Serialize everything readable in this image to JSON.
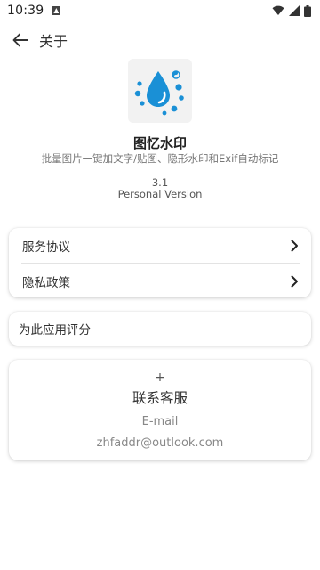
{
  "status_bar": {
    "time": "10:39"
  },
  "app_bar": {
    "title": "关于"
  },
  "app_info": {
    "name": "图忆水印",
    "description": "批量图片一键加文字/贴图、隐形水印和Exif自动标记",
    "version": "3.1",
    "edition": "Personal Version"
  },
  "menu": {
    "service_agreement": "服务协议",
    "privacy_policy": "隐私政策",
    "rate_app": "为此应用评分"
  },
  "contact": {
    "plus": "+",
    "title": "联系客服",
    "email_label": "E-mail",
    "email": "zhfaddr@outlook.com"
  },
  "colors": {
    "logo_blue": "#1a90d6",
    "logo_bg": "#f2f2f2",
    "card_bg": "#ffffff"
  }
}
